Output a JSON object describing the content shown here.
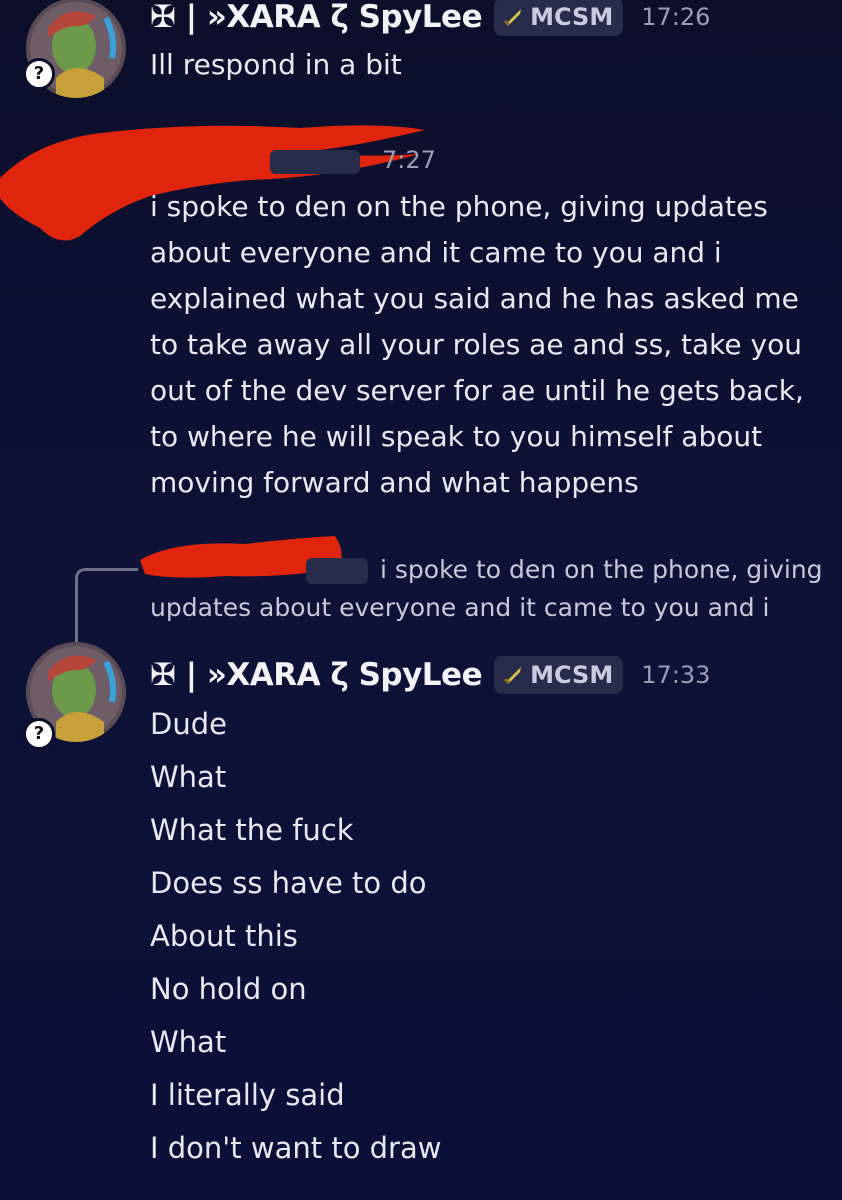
{
  "messages": [
    {
      "author": "✠ | »XARA ζ SpyLee",
      "tag": "MCSM",
      "time": "17:26",
      "status": "?",
      "lines": [
        "Ill respond in a bit"
      ]
    },
    {
      "time_fragment": "7:27",
      "lines": [
        "i spoke to den on the phone, giving updates",
        "about everyone and it came to you and i",
        "explained what you said and he has asked me",
        "to take away all your roles ae and ss, take you",
        "out of the dev server for ae until he gets back,",
        "to where he will speak to you himself about",
        "moving forward and what happens"
      ]
    },
    {
      "reply_preview_line1": "i spoke to den on the phone, giving",
      "reply_preview_line2": "updates about everyone and it came to you and i",
      "author": "✠ | »XARA ζ SpyLee",
      "tag": "MCSM",
      "time": "17:33",
      "status": "?",
      "lines": [
        "Dude",
        "What",
        "What the fuck",
        "Does ss have to do",
        "About this",
        "No hold on",
        "What",
        "I literally said",
        "I don't want to draw"
      ]
    }
  ]
}
